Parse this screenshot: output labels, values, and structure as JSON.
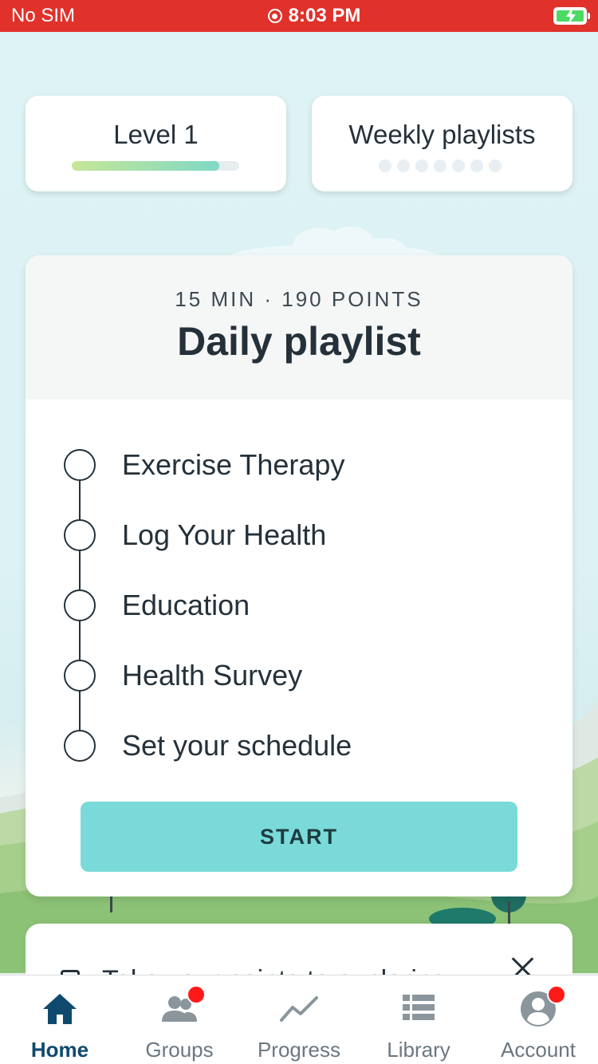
{
  "status_bar": {
    "carrier": "No SIM",
    "time": "8:03 PM",
    "battery_color": "#4cd964",
    "background_color": "#e0312b"
  },
  "level_card": {
    "title": "Level 1",
    "progress_percent": 88
  },
  "weekly_card": {
    "title": "Weekly playlists",
    "completed_dots": 0,
    "total_dots": 7
  },
  "playlist": {
    "meta": "15 MIN · 190 POINTS",
    "title": "Daily playlist",
    "steps": [
      {
        "label": "Exercise Therapy",
        "completed": false
      },
      {
        "label": "Log Your Health",
        "completed": false
      },
      {
        "label": "Education",
        "completed": false
      },
      {
        "label": "Health Survey",
        "completed": false
      },
      {
        "label": "Set your schedule",
        "completed": false
      }
    ],
    "start_label": "START",
    "start_color": "#7adad9"
  },
  "tip_card": {
    "text": "Take your points to exploring..."
  },
  "tab_bar": {
    "active_color": "#0f4a6e",
    "badge_color": "#ff1a1a",
    "tabs": [
      {
        "label": "Home",
        "icon": "home-icon",
        "active": true,
        "badge": false
      },
      {
        "label": "Groups",
        "icon": "groups-icon",
        "active": false,
        "badge": true
      },
      {
        "label": "Progress",
        "icon": "progress-icon",
        "active": false,
        "badge": false
      },
      {
        "label": "Library",
        "icon": "library-icon",
        "active": false,
        "badge": false
      },
      {
        "label": "Account",
        "icon": "account-icon",
        "active": false,
        "badge": true
      }
    ]
  }
}
